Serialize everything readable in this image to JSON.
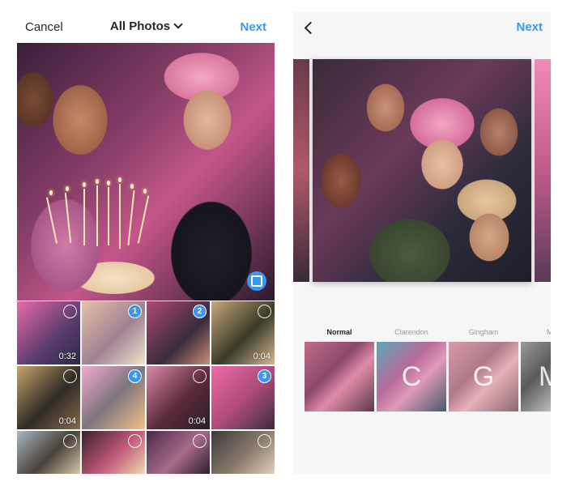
{
  "left": {
    "cancel": "Cancel",
    "title": "All Photos",
    "next": "Next",
    "thumbs": [
      {
        "duration": "0:32",
        "badge": ""
      },
      {
        "duration": "",
        "badge": "1"
      },
      {
        "duration": "",
        "badge": "2"
      },
      {
        "duration": "0:04",
        "badge": ""
      },
      {
        "duration": "0:04",
        "badge": ""
      },
      {
        "duration": "",
        "badge": "4"
      },
      {
        "duration": "0:04",
        "badge": ""
      },
      {
        "duration": "",
        "badge": "3"
      },
      {
        "duration": "",
        "badge": ""
      },
      {
        "duration": "",
        "badge": ""
      },
      {
        "duration": "",
        "badge": ""
      },
      {
        "duration": "",
        "badge": ""
      }
    ]
  },
  "right": {
    "next": "Next",
    "filters": [
      {
        "label": "Normal",
        "letter": ""
      },
      {
        "label": "Clarendon",
        "letter": "C"
      },
      {
        "label": "Gingham",
        "letter": "G"
      },
      {
        "label": "M",
        "letter": "M"
      }
    ]
  },
  "colors": {
    "accent": "#3897f0",
    "text": "#262626"
  }
}
